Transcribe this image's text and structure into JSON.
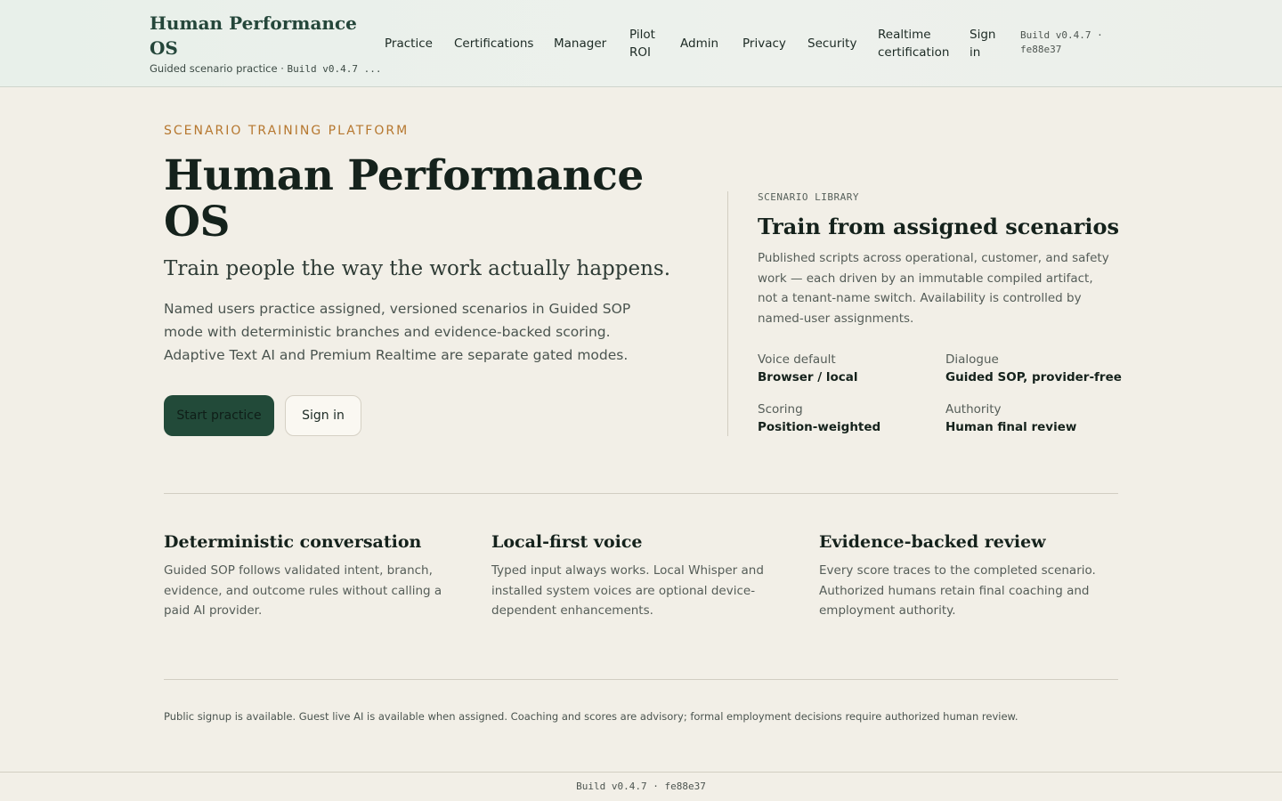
{
  "header": {
    "brand_title": "Human Performance OS",
    "brand_sub_text": "Guided scenario practice · ",
    "brand_sub_build": "Build v0.4.7 ...",
    "nav": [
      {
        "label": "Practice"
      },
      {
        "label": "Certifications"
      },
      {
        "label": "Manager"
      },
      {
        "label": "Pilot ROI"
      },
      {
        "label": "Admin"
      },
      {
        "label": "Privacy"
      },
      {
        "label": "Security"
      },
      {
        "label": "Realtime certification"
      },
      {
        "label": "Sign in"
      }
    ],
    "build": "Build v0.4.7 · fe88e37"
  },
  "hero": {
    "eyebrow": "SCENARIO TRAINING PLATFORM",
    "title": "Human Performance OS",
    "tagline": "Train people the way the work actually happens.",
    "body": "Named users practice assigned, versioned scenarios in Guided SOP mode with deterministic branches and evidence-backed scoring. Adaptive Text AI and Premium Realtime are separate gated modes.",
    "primary_button": "Start practice",
    "secondary_button": "Sign in"
  },
  "library": {
    "eyebrow": "SCENARIO LIBRARY",
    "title": "Train from assigned scenarios",
    "body": "Published scripts across operational, customer, and safety work — each driven by an immutable compiled artifact, not a tenant-name switch. Availability is controlled by named-user assignments.",
    "facts": [
      {
        "label": "Voice default",
        "value": "Browser / local"
      },
      {
        "label": "Dialogue",
        "value": "Guided SOP, provider-free"
      },
      {
        "label": "Scoring",
        "value": "Position-weighted"
      },
      {
        "label": "Authority",
        "value": "Human final review"
      }
    ]
  },
  "features": [
    {
      "title": "Deterministic conversation",
      "body": "Guided SOP follows validated intent, branch, evidence, and outcome rules without calling a paid AI provider."
    },
    {
      "title": "Local-first voice",
      "body": "Typed input always works. Local Whisper and installed system voices are optional device-dependent enhancements."
    },
    {
      "title": "Evidence-backed review",
      "body": "Every score traces to the completed scenario. Authorized humans retain final coaching and employment authority."
    }
  ],
  "notice": "Public signup is available. Guest live AI is available when assigned. Coaching and scores are advisory; formal employment decisions require authorized human review.",
  "footer": {
    "build": "Build v0.4.7 · fe88e37"
  }
}
